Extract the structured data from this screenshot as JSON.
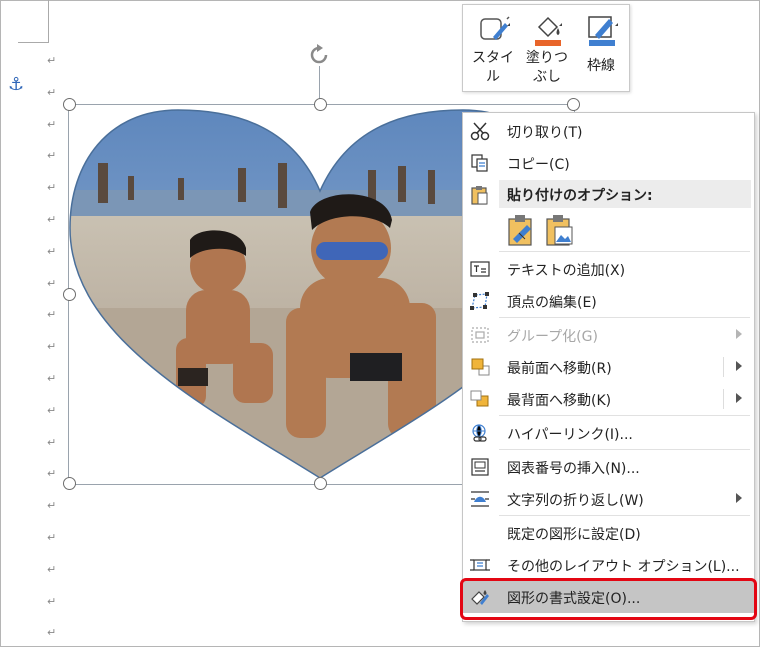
{
  "toolbar": {
    "style_label_1": "スタイ",
    "style_label_2": "ル",
    "fill_label_1": "塗りつ",
    "fill_label_2": "ぶし",
    "outline_label": "枠線"
  },
  "context_menu": {
    "cut": "切り取り(T)",
    "copy": "コピー(C)",
    "paste_options": "貼り付けのオプション:",
    "add_text": "テキストの追加(X)",
    "edit_points": "頂点の編集(E)",
    "group": "グループ化(G)",
    "bring_to_front": "最前面へ移動(R)",
    "send_to_back": "最背面へ移動(K)",
    "hyperlink": "ハイパーリンク(I)...",
    "insert_caption": "図表番号の挿入(N)...",
    "wrap_text": "文字列の折り返し(W)",
    "set_default_shape": "既定の図形に設定(D)",
    "more_layout_options": "その他のレイアウト オプション(L)...",
    "format_shape": "図形の書式設定(O)..."
  },
  "colors": {
    "accent_red": "#e30613",
    "fill_orange": "#e8652a",
    "outline_blue": "#3f7fd0"
  }
}
